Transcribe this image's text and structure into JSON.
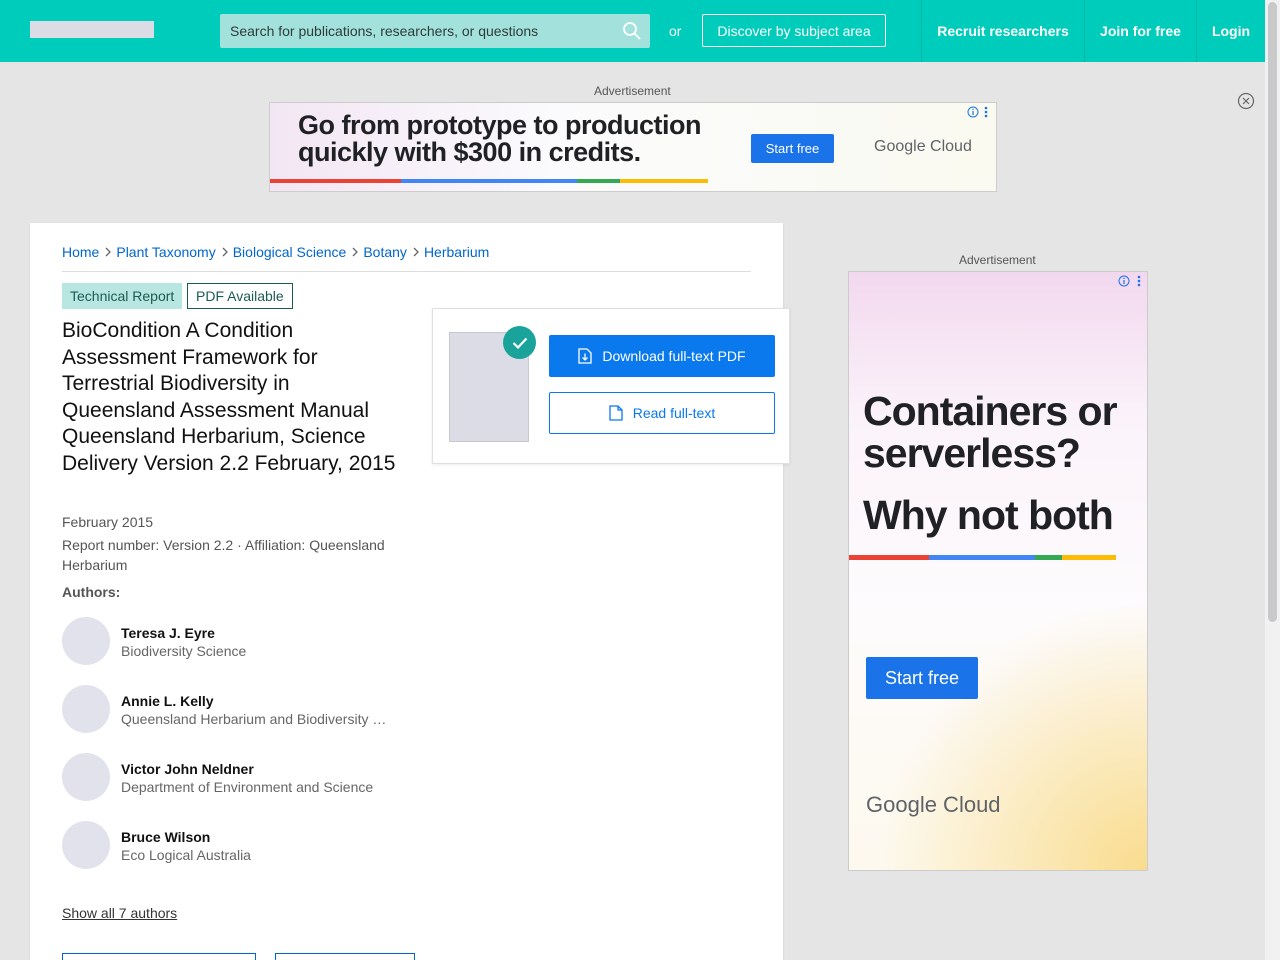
{
  "header": {
    "search_placeholder": "Search for publications, researchers, or questions",
    "or_text": "or",
    "discover_label": "Discover by subject area",
    "nav": {
      "recruit": "Recruit researchers",
      "join": "Join for free",
      "login": "Login"
    }
  },
  "colors": {
    "brand": "#00ccbb",
    "link": "#0066cc",
    "primary_button": "#0a79ee",
    "check_badge": "#1aa39a"
  },
  "top_ad": {
    "label": "Advertisement",
    "headline_line1": "Go from prototype to production",
    "headline_line2": "quickly with $300 in credits.",
    "cta": "Start free",
    "brand": "Google Cloud",
    "info_icon": "info-icon",
    "menu_icon": "more-vert-icon"
  },
  "side_ad": {
    "label": "Advertisement",
    "headline_line1": "Containers or",
    "headline_line2": "serverless?",
    "headline_line3": "Why not both",
    "cta": "Start free",
    "brand": "Google Cloud"
  },
  "breadcrumb": [
    "Home",
    "Plant Taxonomy",
    "Biological Science",
    "Botany",
    "Herbarium"
  ],
  "publication": {
    "type_tag": "Technical Report",
    "pdf_tag": "PDF Available",
    "title": "BioCondition A Condition Assessment Framework for Terrestrial Biodiversity in Queensland Assessment Manual Queensland Herbarium, Science Delivery Version 2.2 February, 2015",
    "date": "February 2015",
    "report_info": "Report number: Version 2.2 · Affiliation: Queensland Herbarium",
    "authors_label": "Authors:",
    "authors": [
      {
        "name": "Teresa J. Eyre",
        "affiliation": "Biodiversity Science"
      },
      {
        "name": "Annie L. Kelly",
        "affiliation": "Queensland Herbarium and Biodiversity …"
      },
      {
        "name": "Victor John Neldner",
        "affiliation": "Department of Environment and Science"
      },
      {
        "name": "Bruce Wilson",
        "affiliation": "Eco Logical Australia"
      }
    ],
    "show_all": "Show all 7 authors"
  },
  "fulltext": {
    "download_label": "Download full-text PDF",
    "read_label": "Read full-text"
  }
}
